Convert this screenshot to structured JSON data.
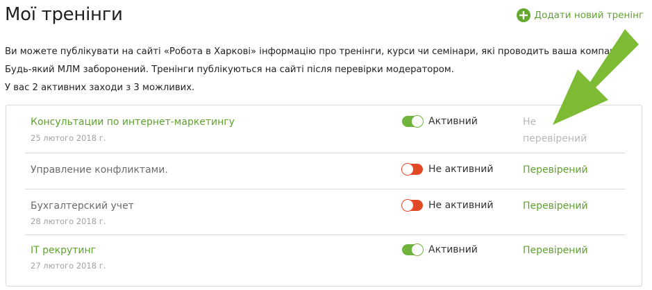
{
  "header": {
    "title": "Мої тренінги",
    "add_label": "Додати новий тренінг"
  },
  "intro": {
    "text": "Ви можете публікувати на сайті «Робота в Харкові» інформацію про тренінги, курси чи семінари, які проводить ваша компанія. Будь-який МЛМ заборонений. Тренінги публікуються на сайті після перевірки модератором.",
    "count": "У вас 2 активних заходи з 3 можливих."
  },
  "trainings": [
    {
      "name": "Консультации по интернет-маркетингу",
      "date": "25 лютого 2018 г.",
      "active": true,
      "toggle_label": "Активний",
      "status": "Не перевірений",
      "status_state": "pending"
    },
    {
      "name": "Управление конфликтами.",
      "date": "",
      "active": false,
      "toggle_label": "Не активний",
      "status": "Перевірений",
      "status_state": "ok"
    },
    {
      "name": "Бухгалтерский учет",
      "date": "28 лютого 2018 г.",
      "active": false,
      "toggle_label": "Не активний",
      "status": "Перевірений",
      "status_state": "ok"
    },
    {
      "name": "IT рекрутинг",
      "date": "27 лютого 2018 г.",
      "active": true,
      "toggle_label": "Активний",
      "status": "Перевірений",
      "status_state": "ok"
    }
  ],
  "colors": {
    "accent_green": "#5fa12e",
    "toggle_on": "#6fb23c",
    "toggle_off": "#e24a26",
    "arrow_green": "#7dbb35"
  }
}
